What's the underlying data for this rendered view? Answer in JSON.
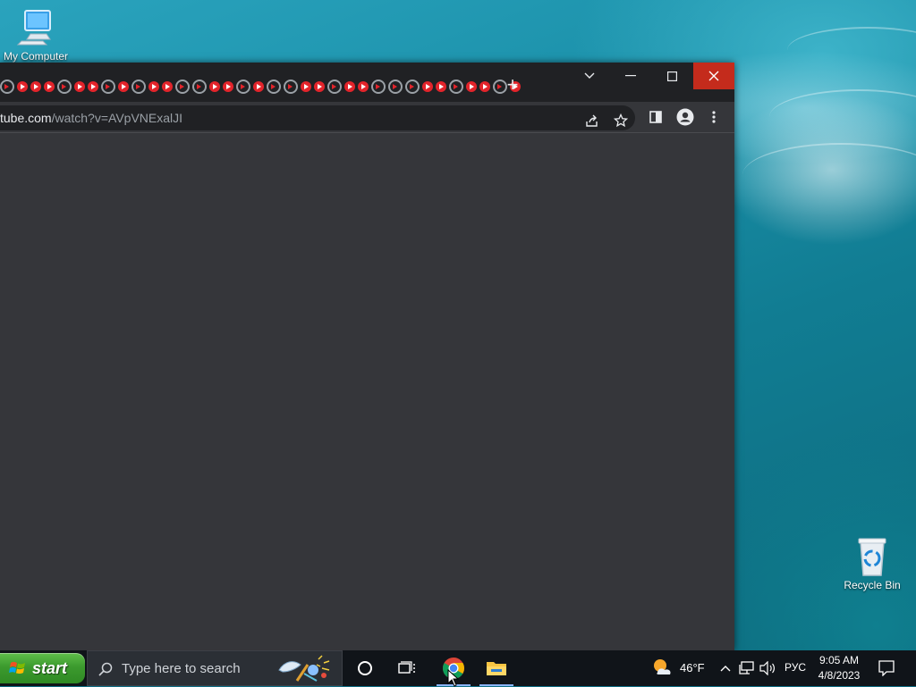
{
  "desktop": {
    "icons": {
      "my_computer": "My Computer",
      "recycle_bin": "Recycle Bin"
    }
  },
  "browser": {
    "tab_favicon": "youtube-favicon",
    "new_tab_symbol": "+",
    "controls": {
      "tab_search": "⌄",
      "minimize": "—",
      "maximize": "☐",
      "close": "✕"
    },
    "url_host": "tube.com",
    "url_path": "/watch?v=AVpVNExalJI",
    "toolbar_icons": [
      "share-icon",
      "bookmark-star-icon",
      "side-panel-icon",
      "profile-icon",
      "menu-icon"
    ]
  },
  "taskbar": {
    "start_label": "start",
    "search_placeholder": "Type here to search",
    "pinned_apps": [
      "cortana-icon",
      "task-view-icon",
      "chrome-icon",
      "file-explorer-icon"
    ],
    "weather_temp": "46°F",
    "language": "РУС",
    "time": "9:05 AM",
    "date": "4/8/2023"
  },
  "colors": {
    "browser_bg": "#35363a",
    "tabstrip_bg": "#202124",
    "close_red": "#c42b1c",
    "start_green": "#3c9a2e",
    "taskbar_bg": "#101419"
  }
}
